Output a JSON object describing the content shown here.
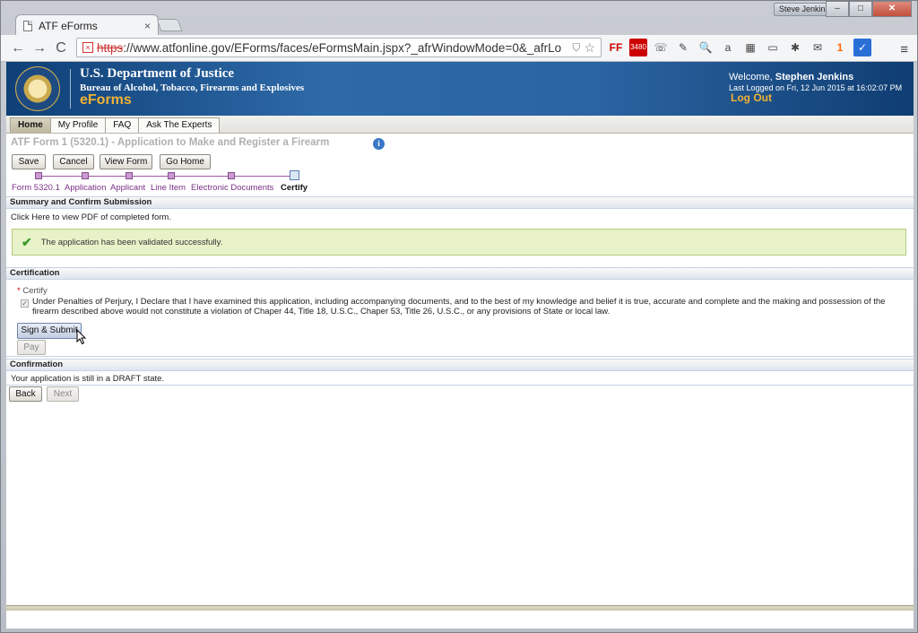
{
  "browser": {
    "tab_title": "ATF eForms",
    "tab_close": "×",
    "profile_name": "Steve Jenkins",
    "window_buttons": [
      "–",
      "□",
      "✕"
    ],
    "nav": {
      "back": "←",
      "forward": "→",
      "reload": "C"
    },
    "url_scheme": "https",
    "url_rest": "://www.atfonline.gov/EForms/faces/eFormsMain.jspx?_afrWindowMode=0&_afrLo",
    "extensions": [
      {
        "name": "ff-ext-icon",
        "glyph": "FF",
        "cls": "red"
      },
      {
        "name": "gmail-count-icon",
        "glyph": "3480",
        "cls": "badge"
      },
      {
        "name": "phone-ext-icon",
        "glyph": "☏",
        "cls": ""
      },
      {
        "name": "eyedropper-ext-icon",
        "glyph": "✎",
        "cls": ""
      },
      {
        "name": "magnifier-ext-icon",
        "glyph": "🔍",
        "cls": ""
      },
      {
        "name": "amazon-ext-icon",
        "glyph": "a",
        "cls": ""
      },
      {
        "name": "chart-ext-icon",
        "glyph": "▦",
        "cls": ""
      },
      {
        "name": "window-ext-icon",
        "glyph": "▭",
        "cls": ""
      },
      {
        "name": "bug-ext-icon",
        "glyph": "✱",
        "cls": ""
      },
      {
        "name": "mail-ext-icon",
        "glyph": "✉",
        "cls": ""
      },
      {
        "name": "notification-ext-icon",
        "glyph": "1",
        "cls": "orange"
      },
      {
        "name": "check-ext-icon",
        "glyph": "✓",
        "cls": "blue"
      }
    ],
    "menu_glyph": "≡"
  },
  "banner": {
    "dept": "U.S. Department of Justice",
    "bureau": "Bureau of Alcohol, Tobacco, Firearms and Explosives",
    "app_name": "eForms",
    "welcome_label": "Welcome,",
    "user_name": "Stephen Jenkins",
    "last_logged": "Last Logged on Fri, 12 Jun 2015 at 16:02:07 PM",
    "logout": "Log Out"
  },
  "menu": [
    {
      "label": "Home",
      "active": true
    },
    {
      "label": "My Profile",
      "active": false
    },
    {
      "label": "FAQ",
      "active": false
    },
    {
      "label": "Ask The Experts",
      "active": false
    }
  ],
  "form": {
    "title": "ATF Form 1 (5320.1) - Application to Make and Register a Firearm",
    "info_glyph": "i",
    "buttons": {
      "save": "Save",
      "cancel": "Cancel",
      "view_form": "View Form",
      "go_home": "Go Home"
    },
    "train": [
      "Form 5320.1",
      "Application",
      "Applicant",
      "Line Item",
      "Electronic Documents",
      "Certify"
    ]
  },
  "summary": {
    "heading": "Summary and Confirm Submission",
    "pdf_link": "Click Here to view PDF of completed form.",
    "validated": "The application has been validated successfully."
  },
  "certification": {
    "heading": "Certification",
    "required_label": "Certify",
    "declaration": "Under Penalties of Perjury, I Declare that I have examined this application, including accompanying documents, and to the best of my knowledge and belief it is true, accurate and complete and the making and possession of the firearm described above would not constitute a violation of Chaper 44, Title 18, U.S.C., Chaper 53, Title 26, U.S.C., or any provisions of State or local law.",
    "sign_submit": "Sign & Submit",
    "pay": "Pay"
  },
  "confirmation": {
    "heading": "Confirmation",
    "status": "Your application is still in a DRAFT state.",
    "back": "Back",
    "next": "Next"
  }
}
